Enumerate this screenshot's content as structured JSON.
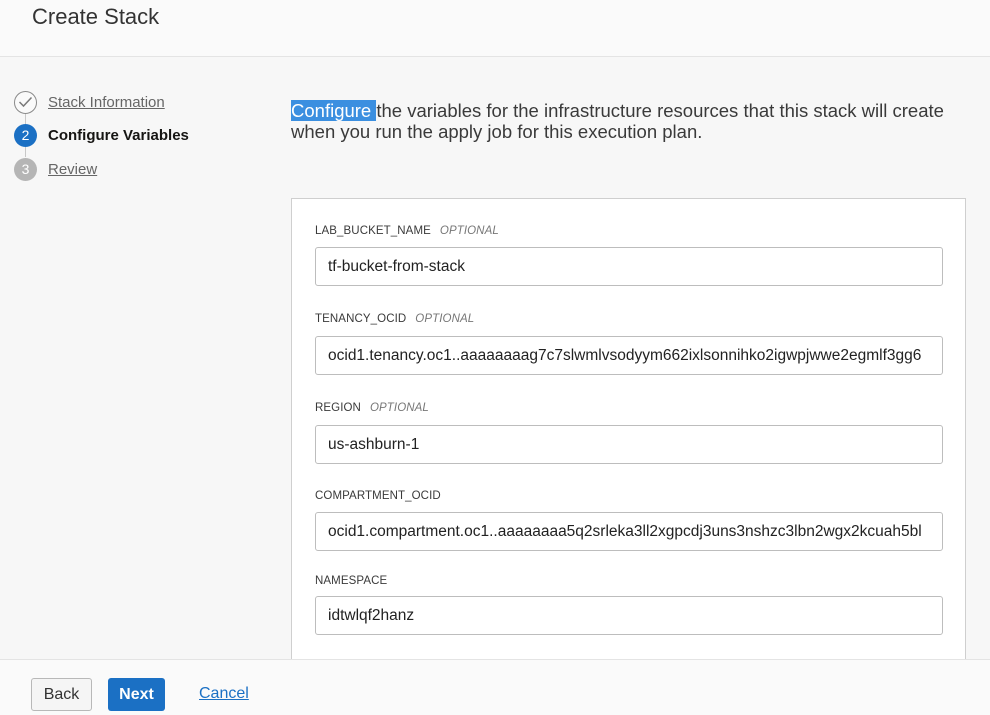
{
  "header": {
    "title": "Create Stack"
  },
  "steps": [
    {
      "number": "",
      "label": "Stack Information",
      "state": "done"
    },
    {
      "number": "2",
      "label": "Configure Variables",
      "state": "active"
    },
    {
      "number": "3",
      "label": "Review",
      "state": "pending"
    }
  ],
  "intro": {
    "highlighted": "Configure ",
    "rest": "the variables for the infrastructure resources that this stack will create when you run the apply job for this execution plan."
  },
  "fields": [
    {
      "name": "LAB_BUCKET_NAME",
      "optional": "OPTIONAL",
      "value": "tf-bucket-from-stack"
    },
    {
      "name": "TENANCY_OCID",
      "optional": "OPTIONAL",
      "value": "ocid1.tenancy.oc1..aaaaaaaag7c7slwmlvsodyym662ixlsonnihko2igwpjwwe2egmlf3gg6"
    },
    {
      "name": "REGION",
      "optional": "OPTIONAL",
      "value": "us-ashburn-1"
    },
    {
      "name": "COMPARTMENT_OCID",
      "optional": "",
      "value": "ocid1.compartment.oc1..aaaaaaaa5q2srleka3ll2xgpcdj3uns3nshzc3lbn2wgx2kcuah5bl"
    },
    {
      "name": "NAMESPACE",
      "optional": "",
      "value": "idtwlqf2hanz"
    }
  ],
  "footer": {
    "back_label": "Back",
    "next_label": "Next",
    "cancel_label": "Cancel"
  },
  "colors": {
    "accent": "#1b70c4",
    "highlight": "#3b8fe0"
  },
  "icons": {
    "step_done": "check-circle-icon"
  }
}
